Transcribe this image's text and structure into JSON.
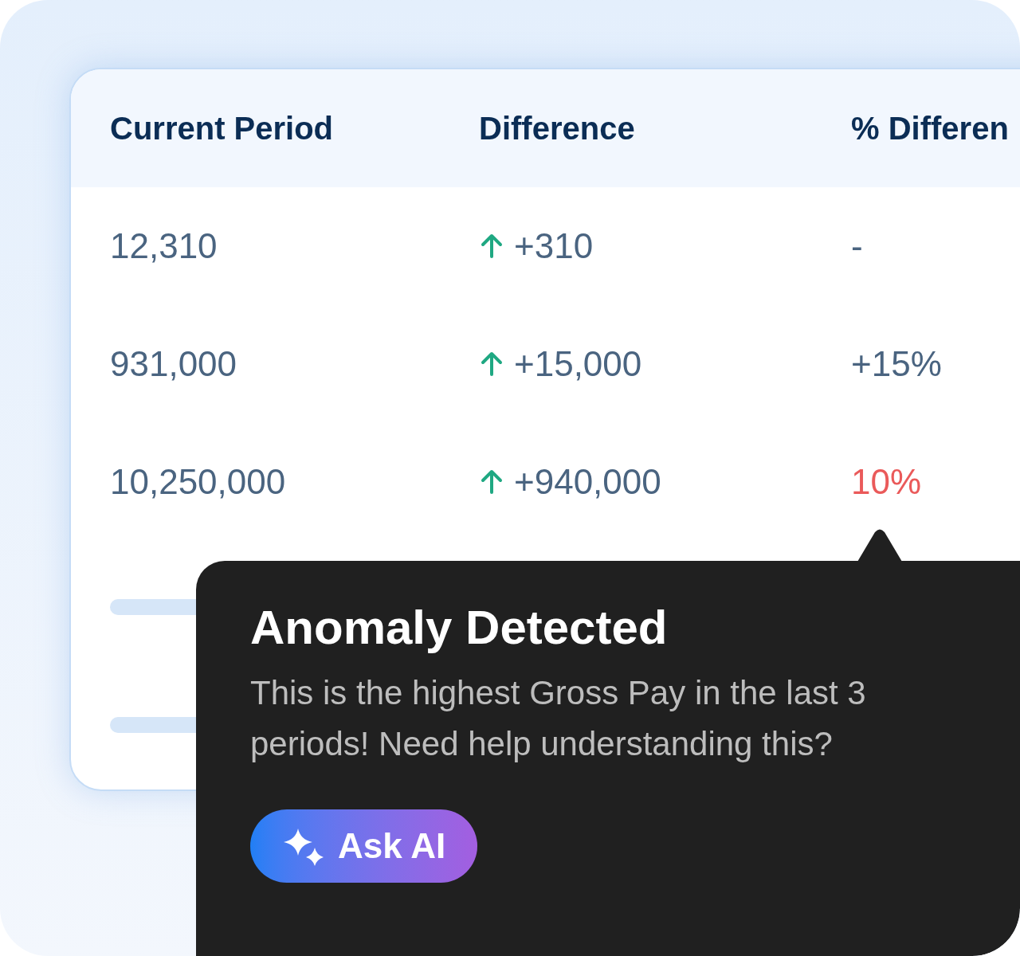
{
  "table": {
    "columns": [
      "Current Period",
      "Difference",
      "% Differen"
    ],
    "rows": [
      {
        "current": "12,310",
        "rising": true,
        "difference": "+310",
        "percent": "-",
        "alert": false
      },
      {
        "current": "931,000",
        "rising": true,
        "difference": "+15,000",
        "percent": "+15%",
        "alert": false
      },
      {
        "current": "10,250,000",
        "rising": true,
        "difference": "+940,000",
        "percent": "10%",
        "alert": true
      }
    ]
  },
  "tooltip": {
    "title": "Anomaly Detected",
    "message": "This is the highest Gross Pay in the last 3 periods! Need help understanding this?",
    "button": "Ask AI"
  }
}
